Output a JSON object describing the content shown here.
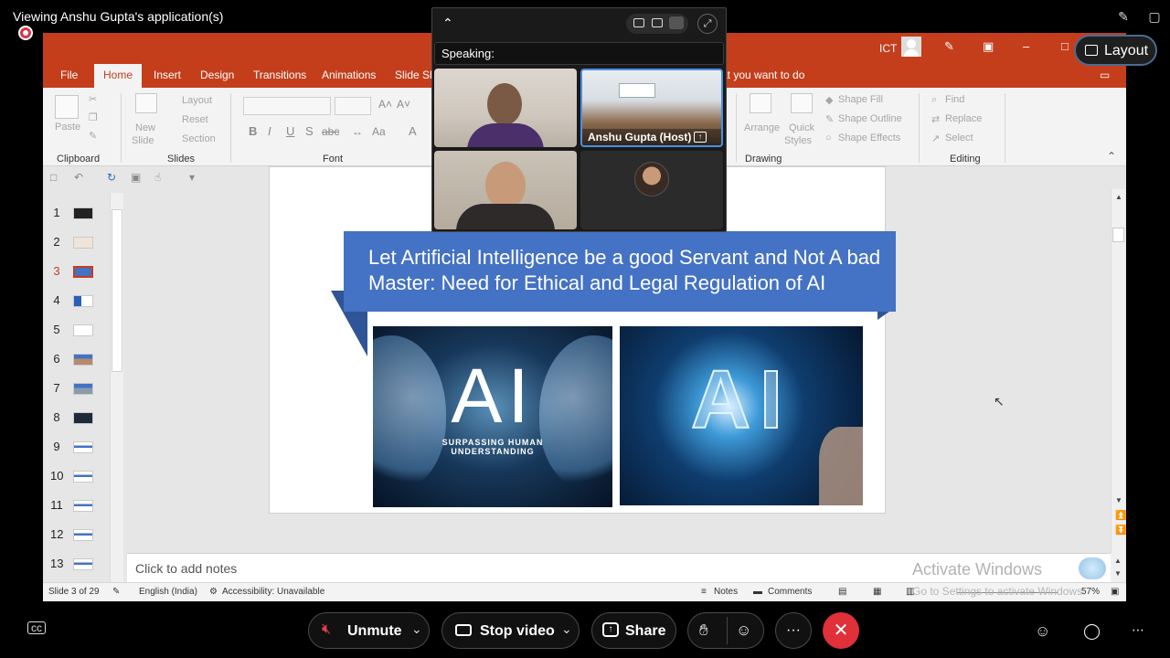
{
  "meeting": {
    "viewing_title": "Viewing Anshu Gupta's application(s)",
    "speaking_label": "Speaking:",
    "host_label": "Anshu Gupta (Host)",
    "layout_label": "Layout"
  },
  "ppt": {
    "tabs": [
      "File",
      "Home",
      "Insert",
      "Design",
      "Transitions",
      "Animations",
      "Slide Sh"
    ],
    "tellme": "at you want to do",
    "user_name": "ICT",
    "ribbon": {
      "paste": "Paste",
      "clipboard": "Clipboard",
      "new_slide_1": "New",
      "new_slide_2": "Slide",
      "layout": "Layout",
      "reset": "Reset",
      "section": "Section",
      "slides": "Slides",
      "font": "Font",
      "bold": "B",
      "italic": "I",
      "underline": "U",
      "strike": "S",
      "abc": "abc",
      "aa": "Aa",
      "a": "A",
      "grow": "A˄",
      "shrink": "A˅",
      "arrange": "Arrange",
      "quick_styles_1": "Quick",
      "quick_styles_2": "Styles",
      "shape_fill": "Shape Fill",
      "shape_outline": "Shape Outline",
      "shape_effects": "Shape Effects",
      "drawing": "Drawing",
      "find": "Find",
      "replace": "Replace",
      "select": "Select",
      "editing": "Editing"
    },
    "thumb_numbers": [
      "1",
      "2",
      "3",
      "4",
      "5",
      "6",
      "7",
      "8",
      "9",
      "10",
      "11",
      "12",
      "13"
    ],
    "slide": {
      "title": "Let Artificial Intelligence be a good Servant and Not A bad Master: Need for Ethical and Legal Regulation of AI",
      "left_image_text": "AI",
      "left_image_sub_1": "SURPASSING HUMAN",
      "left_image_sub_2": "UNDERSTANDING",
      "right_image_text": "AI"
    },
    "notes_placeholder": "Click to add notes",
    "status": {
      "slide_of": "Slide 3 of 29",
      "language": "English (India)",
      "accessibility": "Accessibility: Unavailable",
      "notes": "Notes",
      "comments": "Comments",
      "zoom": "57%"
    },
    "watermark": "Activate Windows",
    "watermark_sub": "Go to Settings to activate Windows."
  },
  "controls": {
    "unmute": "Unmute",
    "stop_video": "Stop video",
    "share": "Share",
    "more": "···"
  },
  "colors": {
    "ppt_accent": "#c43e1c",
    "banner": "#4472c4",
    "end_call": "#e0303a",
    "host_border": "#4a90e2"
  }
}
